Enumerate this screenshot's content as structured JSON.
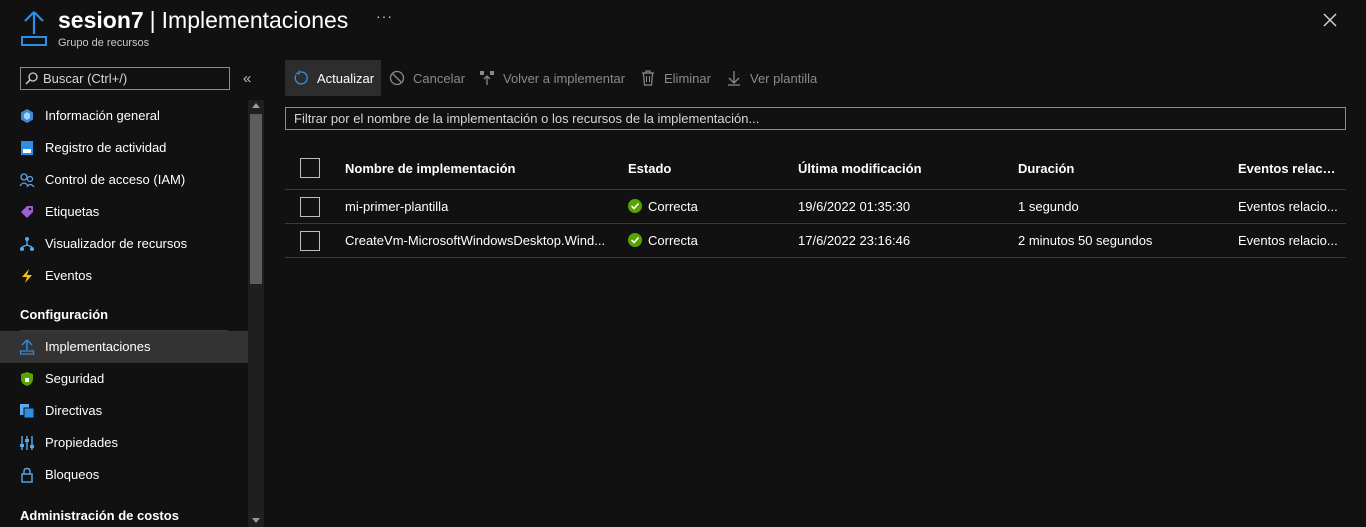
{
  "header": {
    "resource_name": "sesion7",
    "separator": "|",
    "page_title": "Implementaciones",
    "subtitle": "Grupo de recursos",
    "more_label": "···"
  },
  "sidebar": {
    "search_placeholder": "Buscar (Ctrl+/)",
    "collapse_label": "«",
    "items": [
      {
        "label": "Información general",
        "icon": "cube-icon"
      },
      {
        "label": "Registro de actividad",
        "icon": "log-icon"
      },
      {
        "label": "Control de acceso (IAM)",
        "icon": "users-icon"
      },
      {
        "label": "Etiquetas",
        "icon": "tag-icon"
      },
      {
        "label": "Visualizador de recursos",
        "icon": "tree-icon"
      },
      {
        "label": "Eventos",
        "icon": "bolt-icon"
      }
    ],
    "section_config": "Configuración",
    "config_items": [
      {
        "label": "Implementaciones",
        "icon": "upload-icon",
        "active": true
      },
      {
        "label": "Seguridad",
        "icon": "shield-icon"
      },
      {
        "label": "Directivas",
        "icon": "policy-icon"
      },
      {
        "label": "Propiedades",
        "icon": "sliders-icon"
      },
      {
        "label": "Bloqueos",
        "icon": "lock-icon"
      }
    ],
    "section_costs": "Administración de costos"
  },
  "toolbar": {
    "refresh_label": "Actualizar",
    "cancel_label": "Cancelar",
    "redeploy_label": "Volver a implementar",
    "delete_label": "Eliminar",
    "view_template_label": "Ver plantilla"
  },
  "filter": {
    "placeholder": "Filtrar por el nombre de la implementación o los recursos de la implementación..."
  },
  "table": {
    "columns": {
      "name": "Nombre de implementación",
      "state": "Estado",
      "modified": "Última modificación",
      "duration": "Duración",
      "events": "Eventos relacio..."
    },
    "rows": [
      {
        "name": "mi-primer-plantilla",
        "state": "Correcta",
        "modified": "19/6/2022 01:35:30",
        "duration": "1 segundo",
        "events": "Eventos relacio..."
      },
      {
        "name": "CreateVm-MicrosoftWindowsDesktop.Wind...",
        "state": "Correcta",
        "modified": "17/6/2022 23:16:46",
        "duration": "2 minutos 50 segundos",
        "events": "Eventos relacio..."
      }
    ]
  },
  "colors": {
    "background": "#111111",
    "accent_blue": "#3aa0f3",
    "icon_blue": "#2d8ee6",
    "success_green": "#57a300",
    "active_item": "#333333"
  }
}
